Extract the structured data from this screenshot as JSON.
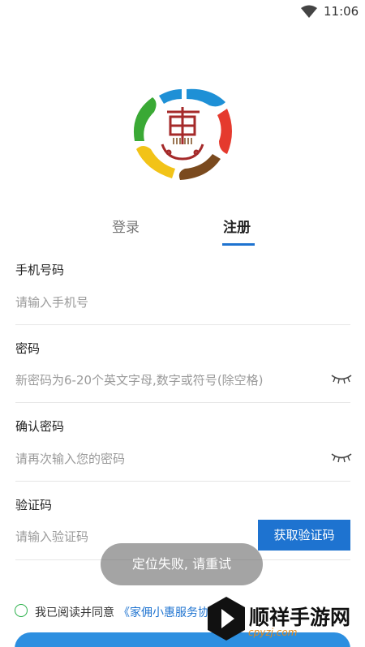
{
  "status_bar": {
    "time": "11:06",
    "wifi_icon": "wifi-icon"
  },
  "logo": {
    "name": "app-logo"
  },
  "tabs": [
    {
      "label": "登录",
      "active": false
    },
    {
      "label": "注册",
      "active": true
    }
  ],
  "form": {
    "phone": {
      "label": "手机号码",
      "placeholder": "请输入手机号"
    },
    "password": {
      "label": "密码",
      "placeholder": "新密码为6-20个英文字母,数字或符号(除空格)",
      "toggle_icon": "eye-closed-icon"
    },
    "confirm_password": {
      "label": "确认密码",
      "placeholder": "请再次输入您的密码",
      "toggle_icon": "eye-closed-icon"
    },
    "verify_code": {
      "label": "验证码",
      "placeholder": "请输入验证码",
      "button_label": "获取验证码"
    }
  },
  "toast": {
    "message": "定位失败, 请重试"
  },
  "agreement": {
    "prefix": "我已阅读并同意",
    "link": "《家佣小惠服务协"
  },
  "watermark": {
    "title": "顺祥手游网",
    "url": "cpyzj.com"
  },
  "colors": {
    "accent": "#1e73d0",
    "check": "#2ab04a"
  }
}
